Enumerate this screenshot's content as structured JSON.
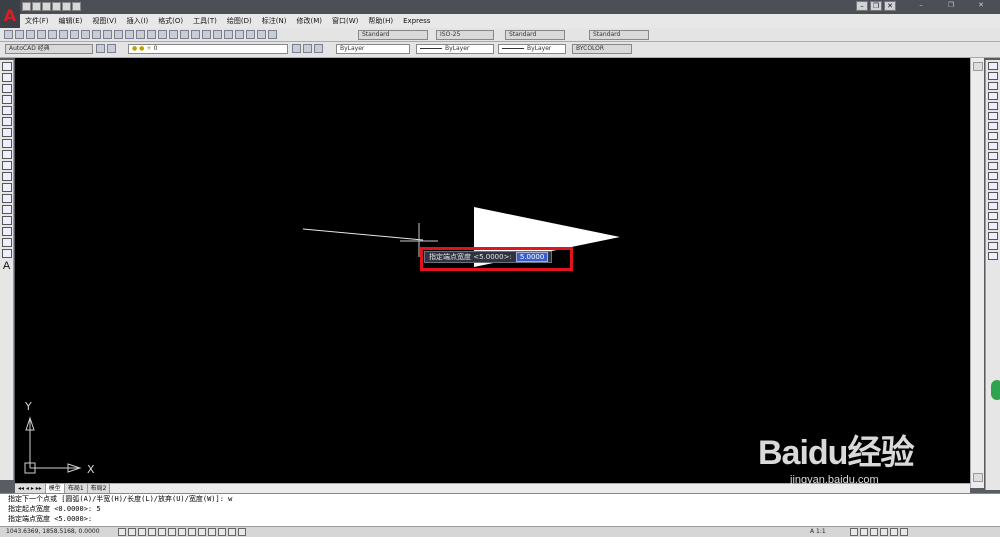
{
  "app": {
    "title": "AutoCAD 经典"
  },
  "menu": [
    "文件(F)",
    "编辑(E)",
    "视图(V)",
    "插入(I)",
    "格式(O)",
    "工具(T)",
    "绘图(D)",
    "标注(N)",
    "修改(M)",
    "窗口(W)",
    "帮助(H)",
    "Express"
  ],
  "toolbar": {
    "workspace": "AutoCAD 经典",
    "layer": "0",
    "text_style": "Standard",
    "dim_style": "ISO-25",
    "table_style": "Standard",
    "multileader_style": "Standard",
    "color": "ByLayer",
    "linetype": "ByLayer",
    "lineweight": "ByLayer",
    "plotstyle": "BYCOLOR"
  },
  "tabs": [
    "模型",
    "布局1",
    "布局2"
  ],
  "dynamic_input": {
    "prompt": "指定端点宽度 <5.0000>:",
    "value": "5.0000"
  },
  "axes": {
    "x": "X",
    "y": "Y"
  },
  "command_history": [
    "指定下一个点或 [圆弧(A)/半宽(H)/长度(L)/放弃(U)/宽度(W)]: w",
    "指定起点宽度 <0.0000>: 5",
    "指定端点宽度 <5.0000>:"
  ],
  "status": {
    "coordinates": "1043.6369, 1858.5168, 0.0000",
    "annotation_scale": "A 1:1"
  },
  "watermark": {
    "brand": "Baidu经验",
    "url": "jingyan.baidu.com"
  },
  "colors": {
    "canvas": "#000000",
    "highlight": "#e0141c",
    "selection": "#3a5fcd"
  }
}
